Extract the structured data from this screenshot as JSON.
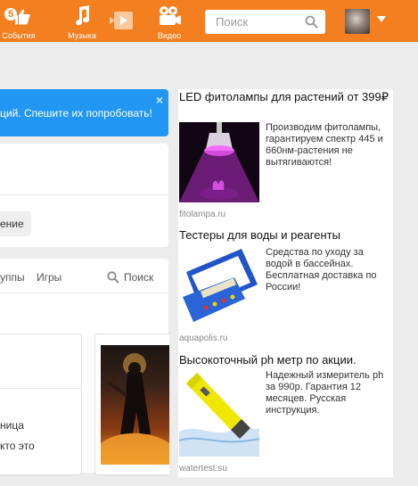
{
  "topbar": {
    "nav": [
      {
        "label": "События",
        "icon": "events-icon",
        "badge": "5"
      },
      {
        "label": "Музыка",
        "icon": "music-note-icon"
      },
      {
        "label": "Видео",
        "icon": "video-camera-icon"
      }
    ],
    "search": {
      "placeholder": "Поиск"
    },
    "colors": {
      "bar": "#f37f1f"
    }
  },
  "main": {
    "banner": {
      "text": "ций. Спешите их попробовать!",
      "close": "×"
    },
    "card_pill": "ение",
    "tabs": [
      {
        "label": "уппы"
      },
      {
        "label": "Игры"
      },
      {
        "label": "Поиск"
      }
    ],
    "sub_card": {
      "lines": [
        "ница",
        "кто это"
      ]
    }
  },
  "ads": [
    {
      "title": "LED фитолампы для растений от 399₽",
      "body": "Производим фитолампы, гарантируем спектр 445 и 660нм-растения не вытягиваются!",
      "domain": "fitolampa.ru"
    },
    {
      "title": "Тестеры для воды и реагенты",
      "body": "Средства по уходу за водой в бассейнах. Бесплатная доставка по России!",
      "domain": "aquapolis.ru"
    },
    {
      "title": "Высокоточный ph метр по акции.",
      "body": "Надежный измеритель ph за 990р. Гарантия 12 месяцев. Русская инструкция.",
      "domain": "watertest.su"
    }
  ]
}
